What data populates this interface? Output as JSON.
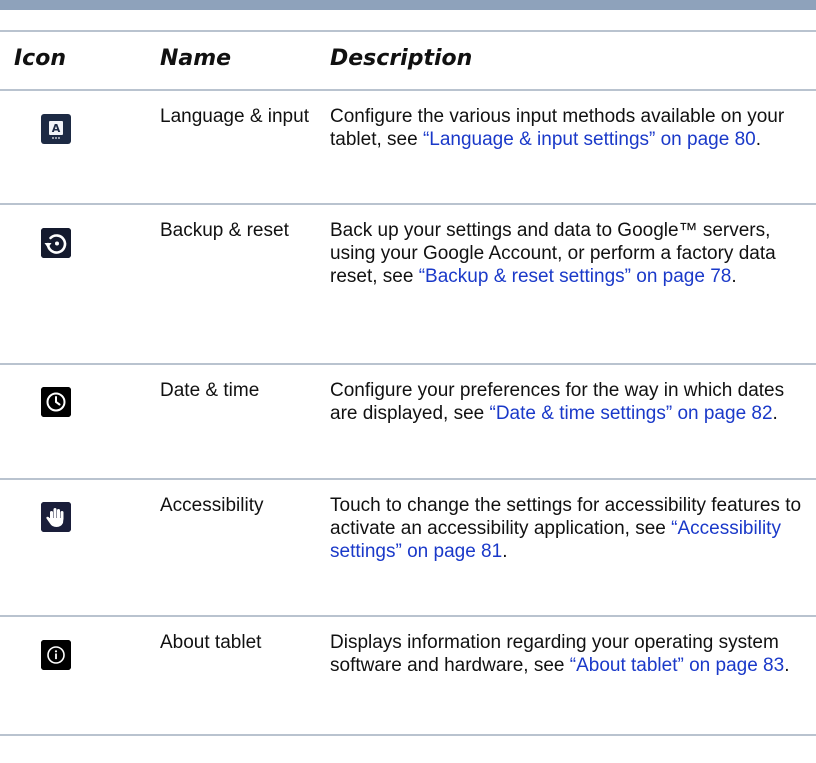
{
  "header": {
    "icon": "Icon",
    "name": "Name",
    "description": "Description"
  },
  "rows": [
    {
      "icon": "language-icon",
      "name": "Language & input",
      "desc_pre": "Configure the various input methods available on your tablet, see ",
      "link": "“Language & input settings” on page 80",
      "desc_post": "."
    },
    {
      "icon": "backup-restore-icon",
      "name": "Backup & reset",
      "desc_pre": "Back up your settings and data to Google™ servers, using your Google Account, or perform a factory data reset, see ",
      "link": "“Backup & reset settings” on page 78",
      "desc_post": "."
    },
    {
      "icon": "clock-icon",
      "name": "Date & time",
      "desc_pre": "Configure your preferences for the way in which dates are displayed, see ",
      "link": "“Date & time settings” on page 82",
      "desc_post": "."
    },
    {
      "icon": "hand-icon",
      "name": "Accessibility",
      "desc_pre": "Touch to change the settings for accessibility features to activate an accessibility application, see ",
      "link": "“Accessibility settings” on page 81",
      "desc_post": "."
    },
    {
      "icon": "info-icon",
      "name": "About tablet",
      "desc_pre": "Displays information regarding your operating system software and hardware, see ",
      "link": "“About tablet” on page 83",
      "desc_post": "."
    }
  ],
  "colors": {
    "top_bar": "#8ea2bb",
    "rule": "#b9c3cf",
    "link": "#1a39c9",
    "icon_bg": "#141a2e"
  }
}
